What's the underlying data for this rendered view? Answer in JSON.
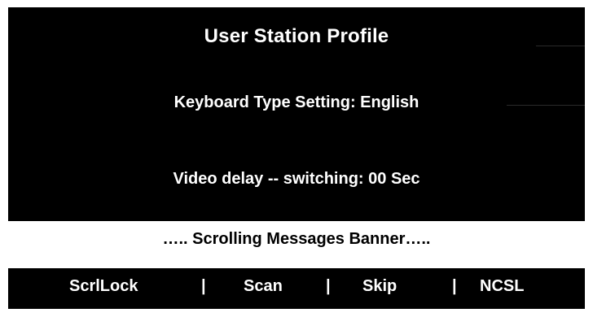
{
  "screen": {
    "title": "User Station Profile",
    "keyboard_setting": "Keyboard Type Setting: English",
    "video_delay": "Video delay -- switching: 00 Sec",
    "banner": "….. Scrolling Messages Banner…..",
    "footer": {
      "scroll_lock": "ScrlLock",
      "separator": "|",
      "scan": "Scan",
      "skip": "Skip",
      "ncsl": "NCSL"
    }
  },
  "colors": {
    "screen_background": "#000000",
    "screen_text": "#ffffff",
    "banner_background": "#ffffff",
    "banner_text": "#000000",
    "page_background": "#ffffff"
  }
}
